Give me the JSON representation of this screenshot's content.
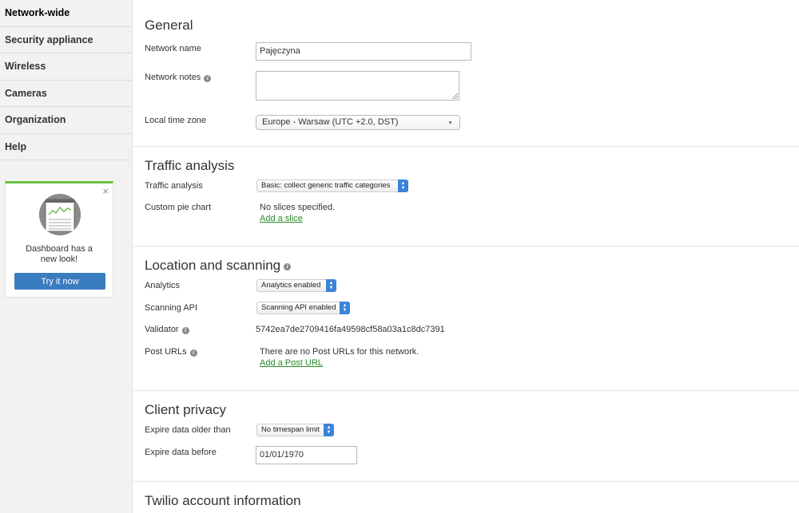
{
  "sidebar": {
    "items": [
      {
        "label": "Network-wide"
      },
      {
        "label": "Security appliance"
      },
      {
        "label": "Wireless"
      },
      {
        "label": "Cameras"
      },
      {
        "label": "Organization"
      },
      {
        "label": "Help"
      }
    ],
    "promo": {
      "close": "×",
      "message_line1": "Dashboard has a",
      "message_line2": "new look!",
      "button": "Try it now"
    }
  },
  "general": {
    "title": "General",
    "network_name_label": "Network name",
    "network_name_value": "Pajęczyna",
    "network_notes_label": "Network notes",
    "network_notes_value": "",
    "time_zone_label": "Local time zone",
    "time_zone_value": "Europe - Warsaw (UTC +2.0, DST)"
  },
  "traffic": {
    "title": "Traffic analysis",
    "analysis_label": "Traffic analysis",
    "analysis_value": "Basic: collect generic traffic categories",
    "pie_label": "Custom pie chart",
    "pie_value": "No slices specified.",
    "pie_link": "Add a slice"
  },
  "location": {
    "title": "Location and scanning",
    "analytics_label": "Analytics",
    "analytics_value": "Analytics enabled",
    "scanning_label": "Scanning API",
    "scanning_value": "Scanning API enabled",
    "validator_label": "Validator",
    "validator_value": "5742ea7de2709416fa49598cf58a03a1c8dc7391",
    "post_label": "Post URLs",
    "post_value": "There are no Post URLs for this network.",
    "post_link": "Add a Post URL"
  },
  "privacy": {
    "title": "Client privacy",
    "expire_older_label": "Expire data older than",
    "expire_older_value": "No timespan limit",
    "expire_before_label": "Expire data before",
    "expire_before_value": "01/01/1970"
  },
  "twilio": {
    "title": "Twilio account information"
  },
  "colors": {
    "link": "#2a8a2a",
    "accent_button": "#3a7cc0",
    "promo_border": "#6cc04a",
    "stepper": "#3c82d8"
  },
  "icons": {
    "info": "i",
    "select_arrow": "▼",
    "stepper_up": "▲",
    "stepper_down": "▼"
  }
}
